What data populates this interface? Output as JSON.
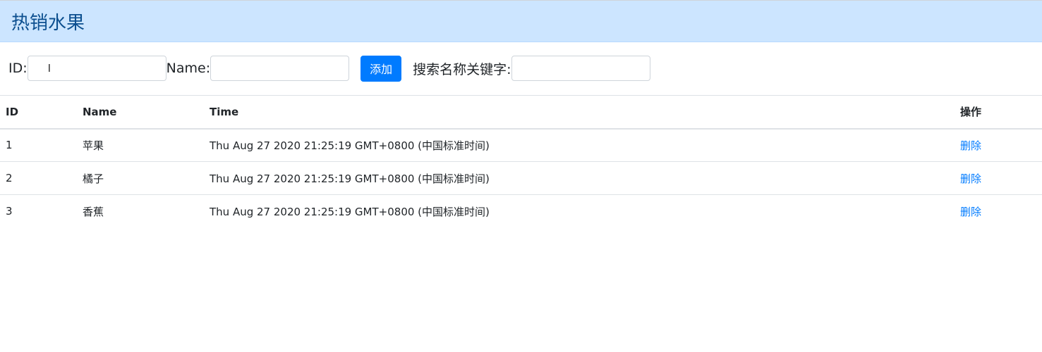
{
  "panel": {
    "title": "热销水果"
  },
  "form": {
    "id_label": "ID:",
    "id_value": "",
    "name_label": "Name:",
    "name_value": "",
    "add_button_label": "添加",
    "search_label": "搜索名称关键字:",
    "search_value": ""
  },
  "table": {
    "headers": {
      "id": "ID",
      "name": "Name",
      "time": "Time",
      "action": "操作"
    },
    "rows": [
      {
        "id": "1",
        "name": "苹果",
        "time": "Thu Aug 27 2020 21:25:19 GMT+0800 (中国标准时间)",
        "action": "删除"
      },
      {
        "id": "2",
        "name": "橘子",
        "time": "Thu Aug 27 2020 21:25:19 GMT+0800 (中国标准时间)",
        "action": "删除"
      },
      {
        "id": "3",
        "name": "香蕉",
        "time": "Thu Aug 27 2020 21:25:19 GMT+0800 (中国标准时间)",
        "action": "删除"
      }
    ]
  },
  "icons": {
    "text_cursor": "I"
  },
  "colors": {
    "header_bg": "#cce5ff",
    "title_color": "#0c4f8f",
    "primary": "#007bff"
  }
}
